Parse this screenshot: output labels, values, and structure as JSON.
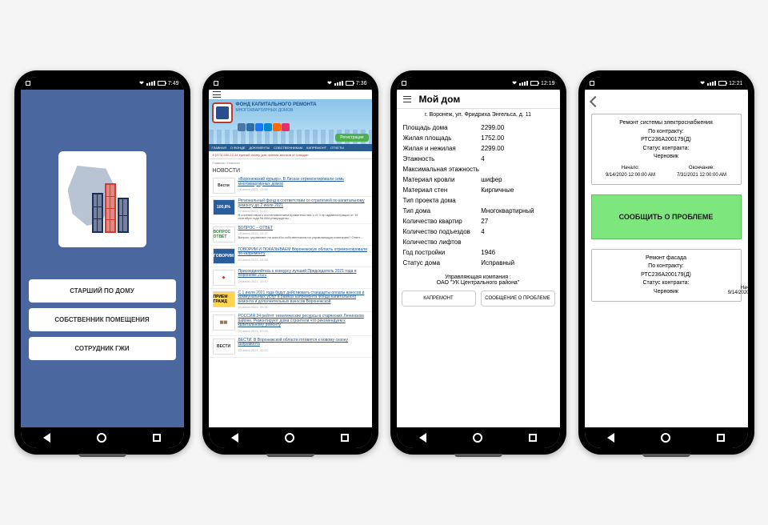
{
  "statusbar": {
    "time1": "7:49",
    "time2": "7:36",
    "time3": "12:19",
    "time4": "12:21"
  },
  "screen1": {
    "buttons": [
      "СТАРШИЙ ПО ДОМУ",
      "СОБСТВЕННИК ПОМЕЩЕНИЯ",
      "СОТРУДНИК ГЖИ"
    ]
  },
  "screen2": {
    "banner_title": "ФОНД КАПИТАЛЬНОГО РЕМОНТА",
    "banner_sub": "МНОГОКВАРТИРНЫХ ДОМОВ",
    "register": "Регистрация",
    "tabs": [
      "ГЛАВНАЯ",
      "О ФОНДЕ",
      "ДОКУМЕНТЫ",
      "СОБСТВЕННИКАМ",
      "КАПРЕМОНТ",
      "ОТЧЕТЫ"
    ],
    "hotline": "8 (473) 280-22-14 единый номер для приема звонков от граждан",
    "crumb": "Главная › Новости",
    "heading": "НОВОСТИ",
    "items": [
      {
        "title": "«Воронежский курьер». В Лисках отремонтировали семь многоквартирных домов",
        "date": "28 июня 2021, 11:08",
        "thumbBg": "#ffffff",
        "thumbFg": "#333",
        "thumbText": "Вести"
      },
      {
        "title": "Региональный фонд в соответствии со стратегией по капитальному ремонту до 2 июля 2021",
        "date": "27 июня 2021, 11:07",
        "desc": "В соответствии с постановлением правительства о ст 1 пр администрации от 19 сентября года № 884 утверждены...",
        "thumbBg": "#2a5d9c",
        "thumbFg": "#fff",
        "thumbText": "100,8%"
      },
      {
        "title": "ВОПРОС – ОТВЕТ",
        "date": "25 июня 2021, 12:37",
        "desc": "Вопрос: управляют ли жалобы собственников на управляющую компанию? Ответ...",
        "thumbBg": "#fff",
        "thumbFg": "#2a8a3a",
        "thumbText": "ВОПРОС\nОТВЕТ"
      },
      {
        "title": "ГОВОРИМ И ПОКАЗЫВАЕМ Воронежскую область отремонтировали по капремонту",
        "date": "24 июня 2021, 10:50",
        "thumbBg": "#2a5d9c",
        "thumbFg": "#fff",
        "thumbText": "ГОВОРИМ"
      },
      {
        "title": "Присоединяйтесь к конкурсу лучший Председатель 2021 года в Воронеже 2021",
        "date": "24 июня 2021, 10:17",
        "thumbBg": "#fff",
        "thumbFg": "#c0392b",
        "thumbText": "◈"
      },
      {
        "title": "С 1 июля 2021 года будут действовать стандарты оплаты взносов и коммунальных услуг в рамках капремонта Фонда капитального ремонта и дополнительных взносов Воронежской",
        "date": "24 июня 2021, 09:11",
        "thumbBg": "#ffd54f",
        "thumbFg": "#000",
        "thumbText": "ПРИЕМ\nГРАЖД"
      },
      {
        "title": "РОССИЯ 24 рейтят тематические ресурсы в старческих Ленинском районе. Ремонтируют дома строители что рекомендуем к капитальному ремонту",
        "date": "24 июня 2021, 07:00",
        "thumbBg": "#fff",
        "thumbFg": "#8b6f47",
        "thumbText": "▦▦"
      },
      {
        "title": "ВЕСТИ. В Воронежской области готовятся к новому сезону капремонта",
        "date": "23 июня 2021, 11:12",
        "thumbBg": "#fff",
        "thumbFg": "#333",
        "thumbText": "ВЕСТИ"
      }
    ]
  },
  "screen3": {
    "title": "Мой дом",
    "address": "г. Воронеж, ул. Фридриха Энгельса, д. 11",
    "props": [
      {
        "label": "Площадь дома",
        "value": "2299.00"
      },
      {
        "label": "Жилая площадь",
        "value": "1752.00"
      },
      {
        "label": "Жилая и нежилая",
        "value": "2299.00"
      },
      {
        "label": "Этажность",
        "value": "4"
      },
      {
        "label": "Максимальная этажность",
        "value": ""
      },
      {
        "label": "Материал кровли",
        "value": "шифер"
      },
      {
        "label": "Материал стен",
        "value": "Кирпичные"
      },
      {
        "label": "Тип проекта дома",
        "value": ""
      },
      {
        "label": "Тип дома",
        "value": "Многоквартирный"
      },
      {
        "label": "Количество квартир",
        "value": "27"
      },
      {
        "label": "Количество подъездов",
        "value": "4"
      },
      {
        "label": "Количество лифтов",
        "value": ""
      },
      {
        "label": "Год постройки",
        "value": "1946"
      },
      {
        "label": "Статус дома",
        "value": "Исправный"
      }
    ],
    "mgmt_label": "Управляющая компания :",
    "mgmt_value": "ОАО \"УК Центрального района\"",
    "btn1": "КАПРЕМОНТ",
    "btn2": "СООБЩЕНИЕ О ПРОБЛЕМЕ"
  },
  "screen4": {
    "cards": [
      {
        "title": "Ремонт системы электроснабжения",
        "by": "По контракту:",
        "num": "РТС236А200179(Д)",
        "status_l": "Статус контракта:",
        "status_v": "Черновик",
        "start_l": "Начало:",
        "start_v": "9/14/2020 12:00:00 AM",
        "end_l": "Окончание:",
        "end_v": "7/31/2021 12:00:00 AM"
      },
      {
        "title": "Ремонт фасада",
        "by": "По контракту:",
        "num": "РТС236А200179(Д)",
        "status_l": "Статус контракта:",
        "status_v": "Черновик"
      }
    ],
    "report": "СООБЩИТЬ О ПРОБЛЕМЕ",
    "side_l1": "Нач",
    "side_l2": "9/14/2020"
  }
}
